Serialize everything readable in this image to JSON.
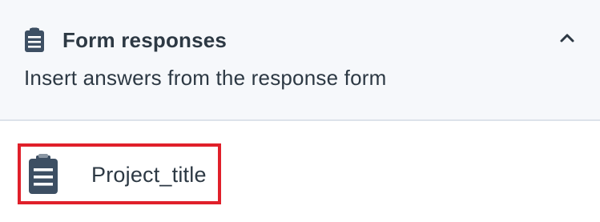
{
  "section": {
    "title": "Form responses",
    "subtitle": "Insert answers from the response form",
    "icon": "clipboard-icon",
    "collapse_icon": "chevron-up-icon",
    "expanded": true
  },
  "fields": [
    {
      "label": "Project_title",
      "icon": "clipboard-icon",
      "highlighted": true
    }
  ],
  "colors": {
    "text": "#2d3944",
    "icon": "#3d4f63",
    "header_bg": "#f6f8fb",
    "divider": "#dde3ea",
    "highlight": "#e0202a"
  }
}
